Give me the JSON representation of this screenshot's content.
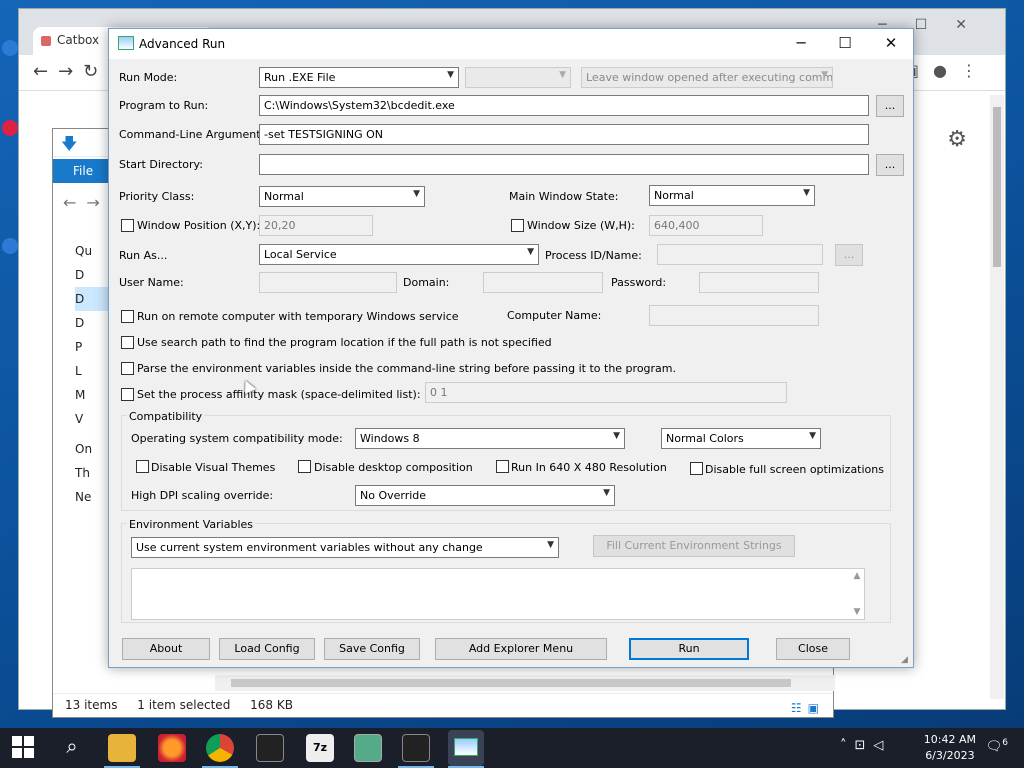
{
  "dialog": {
    "title": "Advanced Run",
    "run_mode": {
      "label": "Run Mode:",
      "value": "Run .EXE File",
      "secondary_value": "",
      "leave_window_value": "Leave window opened after executing comman"
    },
    "program": {
      "label": "Program to Run:",
      "value": "C:\\Windows\\System32\\bcdedit.exe",
      "browse": "..."
    },
    "args": {
      "label": "Command-Line Arguments:",
      "value": "-set TESTSIGNING ON"
    },
    "start_dir": {
      "label": "Start Directory:",
      "value": "",
      "browse": "..."
    },
    "priority": {
      "label": "Priority Class:",
      "value": "Normal"
    },
    "main_window_state": {
      "label": "Main Window State:",
      "value": "Normal"
    },
    "window_position": {
      "label": "Window Position (X,Y):",
      "value": "20,20"
    },
    "window_size": {
      "label": "Window Size (W,H):",
      "value": "640,400"
    },
    "run_as": {
      "label": "Run As...",
      "value": "Local Service"
    },
    "process_id": {
      "label": "Process ID/Name:",
      "value": "",
      "browse": "..."
    },
    "user_name": {
      "label": "User Name:",
      "value": ""
    },
    "domain": {
      "label": "Domain:",
      "value": ""
    },
    "password": {
      "label": "Password:",
      "value": ""
    },
    "remote": {
      "label": "Run on remote computer with temporary Windows service"
    },
    "computer_name": {
      "label": "Computer Name:",
      "value": ""
    },
    "search_path": {
      "label": "Use search path to find the program location if the full path is not specified"
    },
    "parse_env": {
      "label": "Parse the environment variables inside the command-line string before passing it to the program."
    },
    "affinity": {
      "label": "Set the process affinity mask (space-delimited list):",
      "value": "0 1"
    },
    "compat": {
      "group_label": "Compatibility",
      "os_mode_label": "Operating system compatibility mode:",
      "os_mode_value": "Windows 8",
      "colors_value": "Normal Colors",
      "disable_themes": "Disable Visual Themes",
      "disable_composition": "Disable desktop composition",
      "run_640": "Run In 640 X 480 Resolution",
      "disable_fullscreen": "Disable full screen optimizations",
      "dpi_label": "High DPI scaling override:",
      "dpi_value": "No Override"
    },
    "env": {
      "group_label": "Environment Variables",
      "mode_value": "Use current system environment variables without any change",
      "fill_button": "Fill Current Environment Strings"
    },
    "buttons": {
      "about": "About",
      "load": "Load Config",
      "save": "Save Config",
      "explorer": "Add Explorer Menu",
      "run": "Run",
      "close": "Close"
    }
  },
  "chrome": {
    "tab_title": "Catbox"
  },
  "explorer": {
    "ribbon_file": "File",
    "tree_items": [
      "Qu",
      "D",
      "D",
      "D",
      "P",
      "L",
      "M",
      "V",
      "On",
      "Th",
      "Ne"
    ],
    "status_items": "13 items",
    "status_selected": "1 item selected",
    "status_size": "168 KB"
  },
  "taskbar": {
    "time": "10:42 AM",
    "date": "6/3/2023",
    "notifications": "6"
  }
}
